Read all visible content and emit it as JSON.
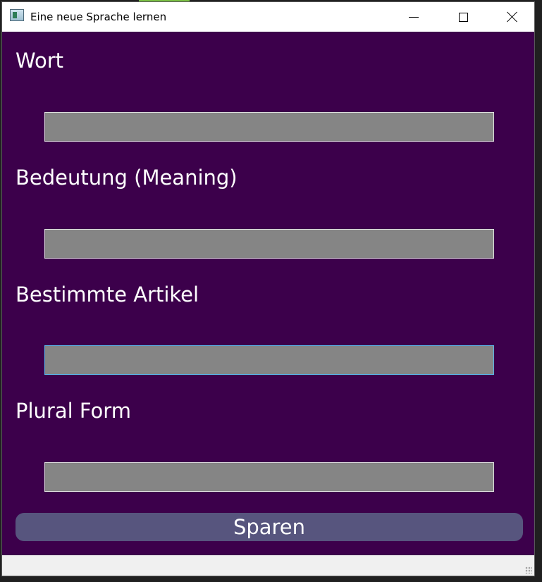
{
  "window": {
    "title": "Eine neue Sprache lernen",
    "icon": "app-window-icon",
    "controls": [
      "minimize-icon",
      "maximize-icon",
      "close-icon"
    ]
  },
  "colors": {
    "background": "#3c004b",
    "input_fill": "#858585",
    "input_border": "#e0e0e0",
    "focus_border": "#5ab4e8",
    "button_fill": "#57557e",
    "text": "#ffffff"
  },
  "form": {
    "fields": [
      {
        "label": "Wort",
        "value": ""
      },
      {
        "label": "Bedeutung (Meaning)",
        "value": ""
      },
      {
        "label": "Bestimmte Artikel",
        "value": ""
      },
      {
        "label": "Plural Form",
        "value": ""
      }
    ],
    "focused_field": "Bestimmte Artikel",
    "save_label": "Sparen"
  }
}
